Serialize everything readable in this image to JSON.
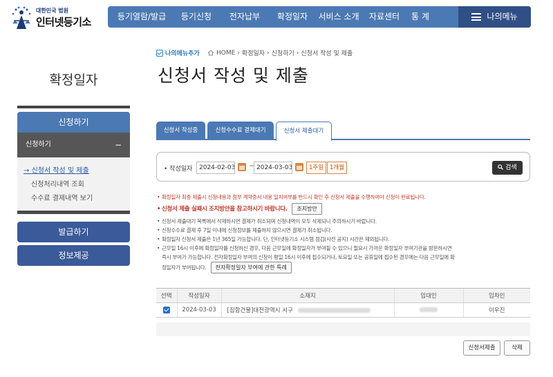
{
  "logo": {
    "small": "대한민국 법원",
    "big": "인터넷등기소"
  },
  "gnb": {
    "items": [
      "등기열람/발급",
      "등기신청",
      "전자납부",
      "확정일자",
      "서비스 소개",
      "자료센터",
      "통 계"
    ],
    "my_menu": "나의메뉴"
  },
  "sidebar": {
    "title": "확정일자",
    "apply": "신청하기",
    "sub": "신청하기",
    "links": [
      "신청서 작성 및 제출",
      "신청처리내역 조회",
      "수수료 결제내역 보기"
    ],
    "issue": "발급하기",
    "info": "정보제공"
  },
  "main": {
    "add_menu": "나의메뉴추가",
    "breadcrumb": [
      "HOME",
      "확정일자",
      "신청하기",
      "신청서 작성 및 제출"
    ],
    "title": "신청서 작성 및 제출",
    "tabs": [
      "신청서 작성중",
      "신청수수료 결제대기",
      "신청서 제출대기"
    ],
    "active_tab": 2
  },
  "search": {
    "label": "작성일자",
    "from": "2024-02-03",
    "tilde": "~",
    "to": "2024-03-03",
    "quick1": "1주일",
    "quick2": "1개월",
    "button": "검색"
  },
  "notices": {
    "n1": "확정일자 최종 제출시 신청내용과 첨부 계약증서 내용 일치여부를 반드시 확인 후 신청서 제출을 수행하여야 신청이 완료됩니다.",
    "n2": "신청서 제출 실패시 조치방안을 참고하시기 바랍니다.",
    "n2_btn": "조치방안",
    "n3": "신청서 제출대기 목록에서 삭제하시면 결제가 취소되며 신청내역이 모두 삭제되니 주의하시기 바랍니다.",
    "n4": "신청수수료 결제 후 7일 이내에 신청정보를 제출하지 않으시면 결제가 취소됩니다.",
    "n5": "확정일자 신청서 제출은 1년 365일 가능합니다. 단, 인터넷등기소 시스템 점검(사전 공지) 시간은 제외됩니다.",
    "n6a": "근무일 16시 이후에 확정일자를 신청하신 경우, 다음 근무일에 확정일자가 부여될 수 있으니 필요시 가까운 확정일자 부여기관을 방문하시면",
    "n6b": "즉시 부여가 가능합니다. 전자확정일자 부여의 신청이 평일 16시 이후에 접수되거나, 토요일 또는 공휴일에 접수된 경우에는 다음 근무일에 확",
    "n6c": "정일자가 부여됩니다.",
    "n6_btn": "전자확정일자 부여에 관한 특례"
  },
  "table": {
    "headers": [
      "선택",
      "작성일자",
      "소재지",
      "임대인",
      "임차인"
    ],
    "rows": [
      {
        "date": "2024-03-03",
        "address": "[집합건물]대전광역시 서구",
        "tenant": "이우진"
      }
    ]
  },
  "actions": {
    "submit": "신청서제출",
    "delete": "삭제"
  },
  "colors": {
    "primary": "#4b79b4",
    "dark": "#2f4f86",
    "accent": "#c0392b"
  }
}
